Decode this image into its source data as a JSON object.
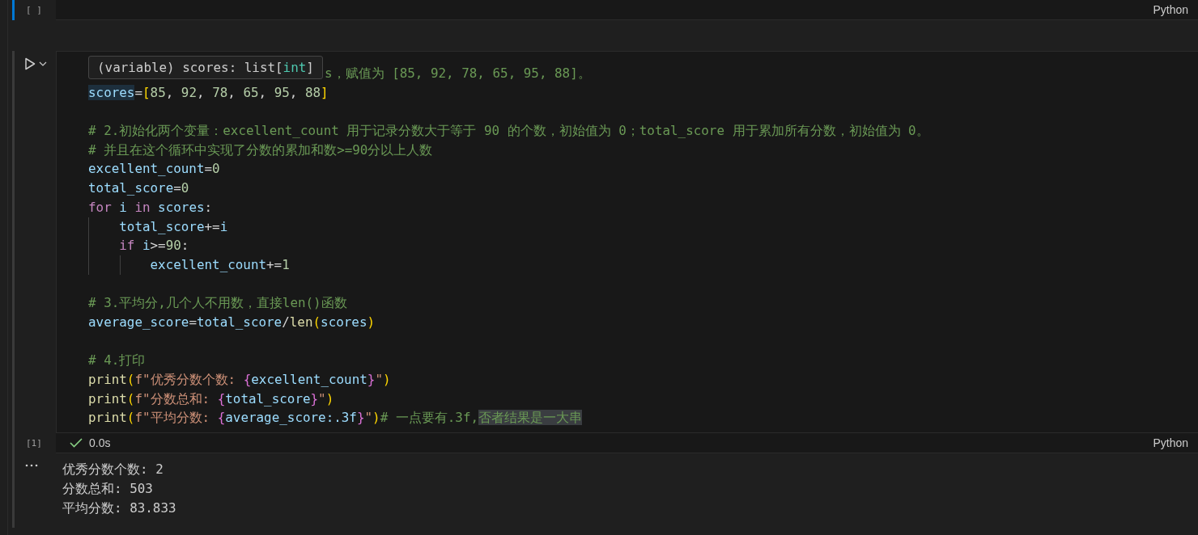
{
  "cells": [
    {
      "focused": true,
      "execution_count": "[ ]",
      "language": "Python"
    },
    {
      "focused": false,
      "execution_count": "[1]",
      "language": "Python",
      "hover": {
        "tokens": [
          {
            "t": "(variable) scores: list[",
            "kind": "plain"
          },
          {
            "t": "int",
            "kind": "type"
          },
          {
            "t": "]",
            "kind": "plain"
          }
        ]
      },
      "lines": [
        {
          "tokens": [
            {
              "t": "s，赋值为 [85, 92, 78, 65, 95, 88]。",
              "kind": "comment"
            }
          ]
        },
        {
          "tokens": [
            {
              "t": "scores",
              "kind": "var-highlighted"
            },
            {
              "t": "=",
              "kind": "op"
            },
            {
              "t": "[",
              "kind": "bracket"
            },
            {
              "t": "85",
              "kind": "num"
            },
            {
              "t": ", ",
              "kind": "op"
            },
            {
              "t": "92",
              "kind": "num"
            },
            {
              "t": ", ",
              "kind": "op"
            },
            {
              "t": "78",
              "kind": "num"
            },
            {
              "t": ", ",
              "kind": "op"
            },
            {
              "t": "65",
              "kind": "num"
            },
            {
              "t": ", ",
              "kind": "op"
            },
            {
              "t": "95",
              "kind": "num"
            },
            {
              "t": ", ",
              "kind": "op"
            },
            {
              "t": "88",
              "kind": "num"
            },
            {
              "t": "]",
              "kind": "bracket"
            }
          ]
        },
        {
          "kind": "blank"
        },
        {
          "tokens": [
            {
              "t": "# 2.初始化两个变量：excellent_count 用于记录分数大于等于 90 的个数，初始值为 0；total_score 用于累加所有分数，初始值为 0。",
              "kind": "comment"
            }
          ]
        },
        {
          "tokens": [
            {
              "t": "# 并且在这个循环中实现了分数的累加和数>=90分以上人数",
              "kind": "comment"
            }
          ]
        },
        {
          "tokens": [
            {
              "t": "excellent_count",
              "kind": "var"
            },
            {
              "t": "=",
              "kind": "op"
            },
            {
              "t": "0",
              "kind": "num"
            }
          ]
        },
        {
          "tokens": [
            {
              "t": "total_score",
              "kind": "var"
            },
            {
              "t": "=",
              "kind": "op"
            },
            {
              "t": "0",
              "kind": "num"
            }
          ]
        },
        {
          "tokens": [
            {
              "t": "for",
              "kind": "keyword"
            },
            {
              "t": " i ",
              "kind": "var"
            },
            {
              "t": "in",
              "kind": "keyword"
            },
            {
              "t": " scores",
              "kind": "var"
            },
            {
              "t": ":",
              "kind": "op"
            }
          ]
        },
        {
          "tokens": [
            {
              "t": "    total_score",
              "kind": "var"
            },
            {
              "t": "+=",
              "kind": "op"
            },
            {
              "t": "i",
              "kind": "var"
            }
          ]
        },
        {
          "tokens": [
            {
              "t": "    if",
              "kind": "keyword"
            },
            {
              "t": " i",
              "kind": "var"
            },
            {
              "t": ">=",
              "kind": "op"
            },
            {
              "t": "90",
              "kind": "num"
            },
            {
              "t": ":",
              "kind": "op"
            }
          ]
        },
        {
          "tokens": [
            {
              "t": "        excellent_count",
              "kind": "var"
            },
            {
              "t": "+=",
              "kind": "op"
            },
            {
              "t": "1",
              "kind": "num"
            }
          ]
        },
        {
          "kind": "blank"
        },
        {
          "tokens": [
            {
              "t": "# 3.平均分,几个人不用数，直接len()函数",
              "kind": "comment"
            }
          ]
        },
        {
          "tokens": [
            {
              "t": "average_score",
              "kind": "var"
            },
            {
              "t": "=",
              "kind": "op"
            },
            {
              "t": "total_score",
              "kind": "var"
            },
            {
              "t": "/",
              "kind": "op"
            },
            {
              "t": "len",
              "kind": "func"
            },
            {
              "t": "(",
              "kind": "bracket"
            },
            {
              "t": "scores",
              "kind": "var"
            },
            {
              "t": ")",
              "kind": "bracket"
            }
          ]
        },
        {
          "kind": "blank"
        },
        {
          "tokens": [
            {
              "t": "# 4.打印",
              "kind": "comment"
            }
          ]
        },
        {
          "tokens": [
            {
              "t": "print",
              "kind": "func"
            },
            {
              "t": "(",
              "kind": "bracket"
            },
            {
              "t": "f\"优秀分数个数: ",
              "kind": "string"
            },
            {
              "t": "{",
              "kind": "brace"
            },
            {
              "t": "excellent_count",
              "kind": "var"
            },
            {
              "t": "}",
              "kind": "brace"
            },
            {
              "t": "\"",
              "kind": "string"
            },
            {
              "t": ")",
              "kind": "bracket"
            }
          ]
        },
        {
          "tokens": [
            {
              "t": "print",
              "kind": "func"
            },
            {
              "t": "(",
              "kind": "bracket"
            },
            {
              "t": "f\"分数总和: ",
              "kind": "string"
            },
            {
              "t": "{",
              "kind": "brace"
            },
            {
              "t": "total_score",
              "kind": "var"
            },
            {
              "t": "}",
              "kind": "brace"
            },
            {
              "t": "\"",
              "kind": "string"
            },
            {
              "t": ")",
              "kind": "bracket"
            }
          ]
        },
        {
          "tokens": [
            {
              "t": "print",
              "kind": "func"
            },
            {
              "t": "(",
              "kind": "bracket"
            },
            {
              "t": "f\"平均分数: ",
              "kind": "string"
            },
            {
              "t": "{",
              "kind": "brace"
            },
            {
              "t": "average_score",
              "kind": "var"
            },
            {
              "t": ":.3f",
              "kind": "spec"
            },
            {
              "t": "}",
              "kind": "brace"
            },
            {
              "t": "\"",
              "kind": "string"
            },
            {
              "t": ")",
              "kind": "bracket"
            },
            {
              "t": "# 一点要有.3f,",
              "kind": "comment"
            },
            {
              "t": "否者结果是一大串",
              "kind": "comment-selected"
            }
          ]
        }
      ],
      "status": {
        "success": true,
        "duration": "0.0s"
      },
      "output": {
        "lines": [
          "优秀分数个数: 2",
          "分数总和: 503",
          "平均分数: 83.833"
        ]
      }
    }
  ]
}
